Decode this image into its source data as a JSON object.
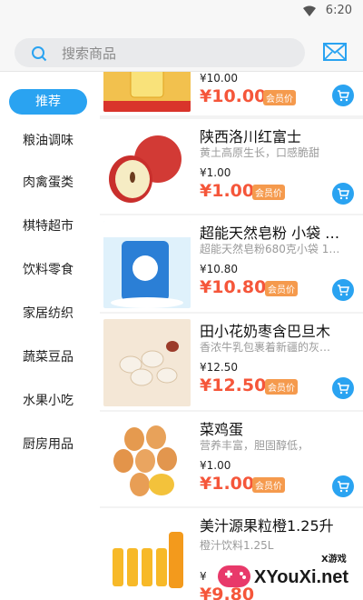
{
  "status": {
    "time": "6:20"
  },
  "search": {
    "placeholder": "搜索商品"
  },
  "categories": [
    {
      "label": "推荐"
    },
    {
      "label": "粮油调味"
    },
    {
      "label": "肉禽蛋类"
    },
    {
      "label": "棋特超市"
    },
    {
      "label": "饮料零食"
    },
    {
      "label": "家居纺织"
    },
    {
      "label": "蔬菜豆品"
    },
    {
      "label": "水果小吃"
    },
    {
      "label": "厨房用品"
    }
  ],
  "products": [
    {
      "name": "",
      "desc": "",
      "orig_price": "¥10.00",
      "member_price": "¥10.00",
      "badge": "会员价"
    },
    {
      "name": "陕西洛川红富士",
      "desc": "黄土高原生长，口感脆甜",
      "orig_price": "¥1.00",
      "member_price": "¥1.00",
      "badge": "会员价"
    },
    {
      "name": "超能天然皂粉 小袋 …",
      "desc": "超能天然皂粉680克小袋 1…",
      "orig_price": "¥10.80",
      "member_price": "¥10.80",
      "badge": "会员价"
    },
    {
      "name": "田小花奶枣含巴旦木",
      "desc": "香浓牛乳包裹着新疆的灰…",
      "orig_price": "¥12.50",
      "member_price": "¥12.50",
      "badge": "会员价"
    },
    {
      "name": "菜鸡蛋",
      "desc": "营养丰富，胆固醇低，",
      "orig_price": "¥1.00",
      "member_price": "¥1.00",
      "badge": "会员价"
    },
    {
      "name": "美汁源果粒橙1.25升",
      "desc": "橙汁饮料1.25L",
      "orig_price": "¥",
      "member_price": "¥9.80",
      "badge": ""
    }
  ],
  "watermark": {
    "text": "XYouXi.net",
    "small": "X游戏"
  },
  "colors": {
    "accent": "#2aa3f1",
    "price": "#f5563a",
    "badge": "#f59a4d"
  }
}
